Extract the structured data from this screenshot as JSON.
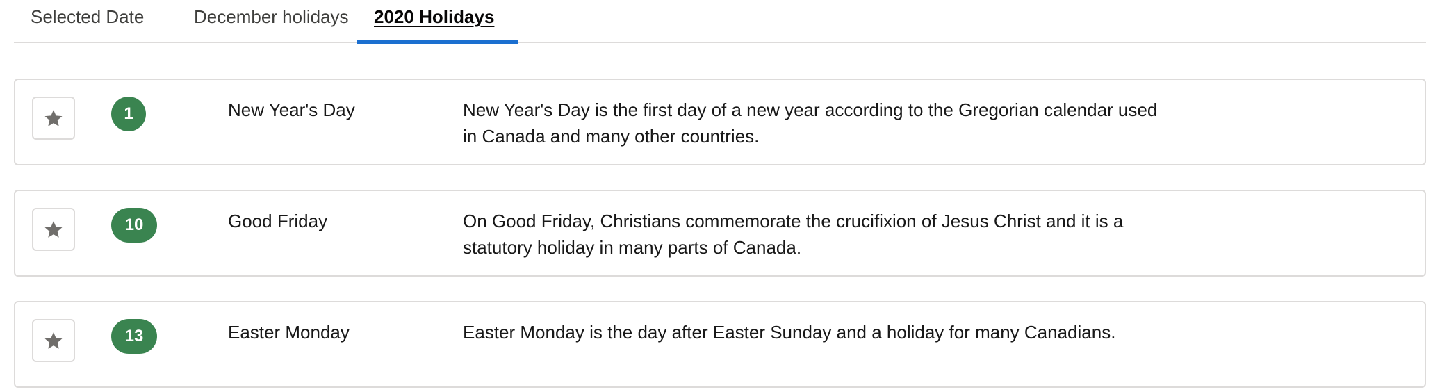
{
  "tabs": [
    {
      "label": "Selected Date"
    },
    {
      "label": "December holidays"
    },
    {
      "label": "2020 Holidays"
    }
  ],
  "active_tab": "2020 Holidays",
  "colors": {
    "accent": "#1b6fd0",
    "badge": "#3a8450",
    "border": "#dddbda",
    "star": "#706e6b"
  },
  "holidays": [
    {
      "day": "1",
      "name": "New Year's Day",
      "description": "New Year's Day is the first day of a new year according to the Gregorian calendar used in Canada and many other countries.",
      "icon": "star-icon"
    },
    {
      "day": "10",
      "name": "Good Friday",
      "description": "On Good Friday, Christians commemorate the crucifixion of Jesus Christ and it is a statutory holiday in many parts of Canada.",
      "icon": "star-icon"
    },
    {
      "day": "13",
      "name": "Easter Monday",
      "description": "Easter Monday is the day after Easter Sunday and a holiday for many Canadians.",
      "icon": "star-icon"
    }
  ]
}
